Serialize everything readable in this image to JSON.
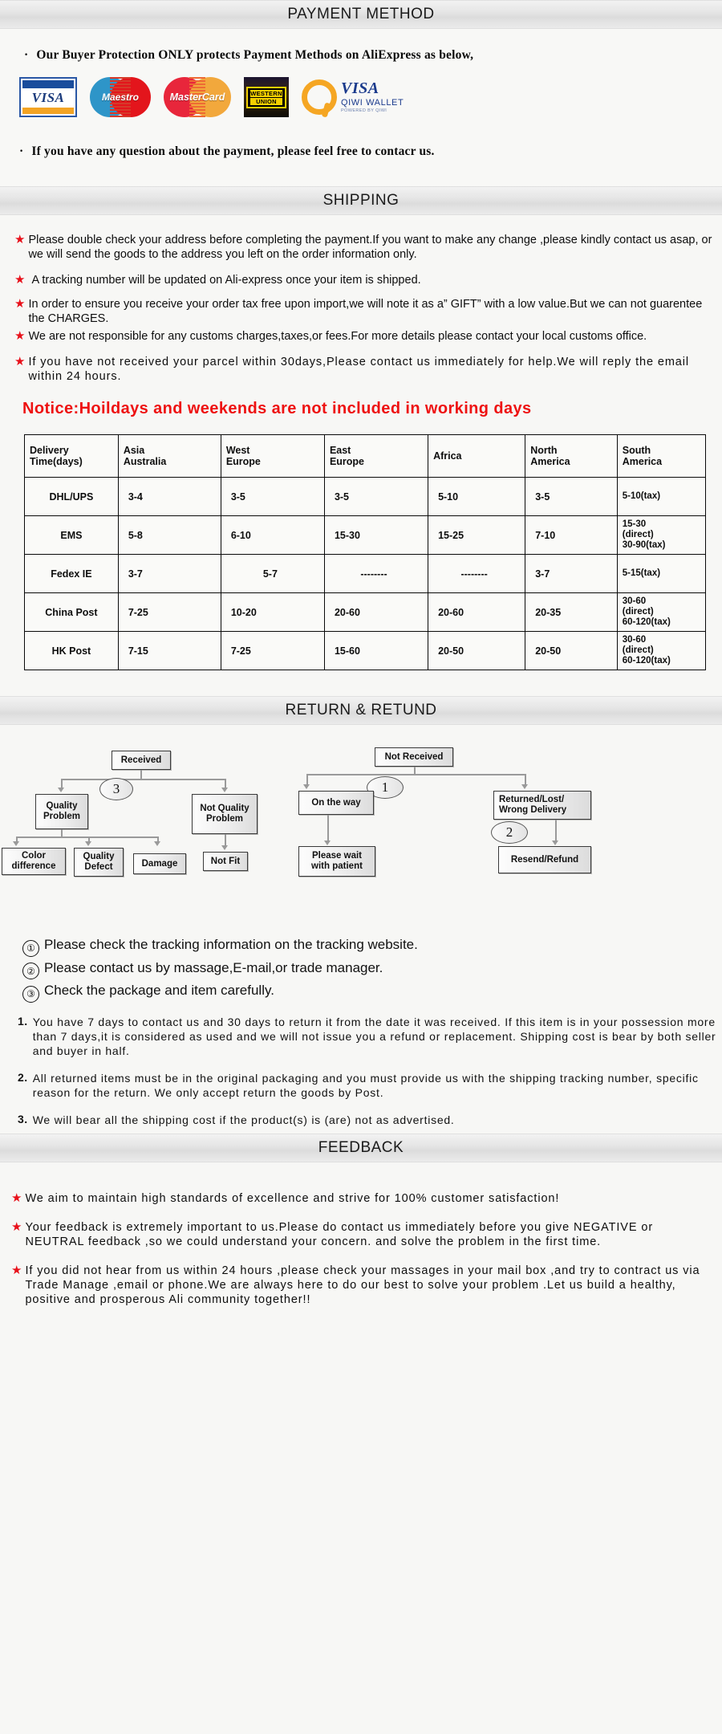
{
  "sections": {
    "payment_title": "PAYMENT METHOD",
    "shipping_title": "SHIPPING",
    "return_title": "RETURN & RETUND",
    "feedback_title": "FEEDBACK"
  },
  "payment": {
    "line1": "Our Buyer Protection ONLY protects Payment Methods on AliExpress as below,",
    "line2": "If you have any question about the payment, please feel free to contacr us.",
    "bullet": "·",
    "logos": [
      {
        "name": "visa-logo",
        "label": "VISA"
      },
      {
        "name": "maestro-logo",
        "label": "Maestro"
      },
      {
        "name": "mastercard-logo",
        "label": "MasterCard"
      },
      {
        "name": "western-union-logo",
        "label_top": "WESTERN",
        "label_bottom": "UNION"
      },
      {
        "name": "qiwi-visa-wallet-logo",
        "visa": "VISA",
        "wallet": "QIWI WALLET",
        "powered": "POWERED BY QIWI"
      }
    ]
  },
  "shipping": {
    "star_glyph": "★",
    "conditions": [
      "Please double check your address before completing the payment.If you want to make any change ,please kindly contact us asap, or we will send the goods to the address you left on the order information only.",
      "A tracking number will be updated on Ali-express once your item is shipped.",
      "In order to ensure you receive your order tax free upon import,we will note it as a” GIFT” with a low value.But we can not guarentee the CHARGES.",
      "We are not responsible for any customs charges,taxes,or fees.For more details please contact your local customs office.",
      "If you have not received your parcel within 30days,Please contact us immediately for help.We will reply the email within 24 hours."
    ],
    "notice": "Notice:Hoildays and weekends are not included in working days"
  },
  "shipping_table": {
    "headers": [
      "Delivery\nTime(days)",
      "Asia\nAustralia",
      "West\nEurope",
      "East\nEurope",
      "Africa",
      "North\nAmerica",
      "South\nAmerica"
    ],
    "rows": [
      {
        "method": "DHL/UPS",
        "values": [
          "3-4",
          "3-5",
          "3-5",
          "5-10",
          "3-5",
          "5-10(tax)"
        ]
      },
      {
        "method": "EMS",
        "values": [
          "5-8",
          "6-10",
          "15-30",
          "15-25",
          "7-10",
          "15-30\n(direct)\n30-90(tax)"
        ]
      },
      {
        "method": "Fedex IE",
        "values": [
          "3-7",
          "5-7",
          "--------",
          "--------",
          "3-7",
          "5-15(tax)"
        ]
      },
      {
        "method": "China Post",
        "values": [
          "7-25",
          "10-20",
          "20-60",
          "20-60",
          "20-35",
          "30-60\n(direct)\n60-120(tax)"
        ]
      },
      {
        "method": "HK Post",
        "values": [
          "7-15",
          "7-25",
          "15-60",
          "20-50",
          "20-50",
          "30-60\n(direct)\n60-120(tax)"
        ]
      }
    ]
  },
  "flowchart": {
    "left": {
      "root": "Received",
      "marker": "3",
      "branch_a": "Quality\nProblem",
      "branch_b": "Not Quality\nProblem",
      "leaves_a": [
        "Color\ndifference",
        "Quality\nDefect",
        "Damage"
      ],
      "leaves_b": [
        "Not Fit"
      ]
    },
    "right": {
      "root": "Not  Received",
      "marker1": "1",
      "marker2": "2",
      "branch_a": "On the way",
      "branch_b": "Returned/Lost/\nWrong Delivery",
      "leaf_a": "Please wait\nwith patient",
      "leaf_b": "Resend/Refund"
    }
  },
  "circled_notes": [
    {
      "num": "①",
      "text": "Please check the tracking information on the tracking website."
    },
    {
      "num": "②",
      "text": "Please contact us by  massage,E-mail,or trade manager."
    },
    {
      "num": "③",
      "text": "Check the package and item carefully."
    }
  ],
  "return_policy": [
    {
      "num": "1.",
      "text": "You have 7 days to contact us and 30 days to return it from the date it was received. If this item is in your possession more than 7 days,it is considered as used and we will not issue you a refund or replacement. Shipping cost is bear by both seller and buyer in half."
    },
    {
      "num": "2.",
      "text": "All returned items must be in the original packaging and you must provide us with the shipping tracking number, specific reason for the return. We only accept return the goods by Post."
    },
    {
      "num": "3.",
      "text": "We will bear all the shipping cost if the product(s) is (are) not as advertised."
    }
  ],
  "feedback": [
    "We aim to maintain high standards of excellence and strive  for 100% customer satisfaction!",
    "Your feedback is extremely important to us.Please do contact us immediately before you give NEGATIVE or NEUTRAL feedback ,so  we could understand your concern. and solve the problem in the first time.",
    "If you did not hear from us within 24 hours ,please check your massages in your mail box ,and try to contract us via Trade Manage ,email or phone.We are always here to do our best to solve your problem .Let us build a healthy, positive and prosperous Ali community together!!"
  ],
  "colors": {
    "star_red": "#e8101a",
    "notice_red": "#ee1111",
    "banner_gray": "#e6e6e6",
    "page_bg": "#f7f7f5"
  }
}
